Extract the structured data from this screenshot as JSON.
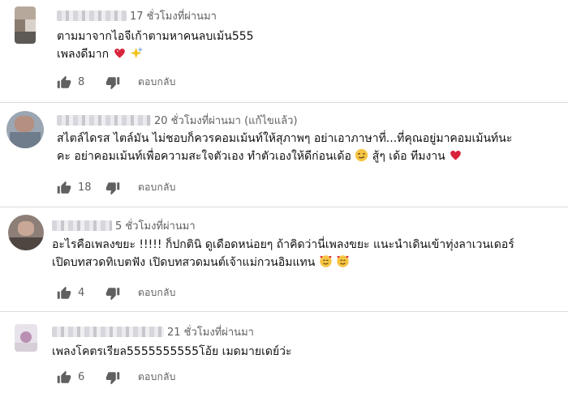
{
  "comments": [
    {
      "time": "17 ชั่วโมงที่ผ่านมา",
      "lines": [
        "ตามมาจากไอจีเก้าตามหาคนลบเม้น555",
        "เพลงดีมาก"
      ],
      "emojis": [
        "heart-sparkling-icon",
        "sparkles-icon"
      ],
      "likes": "8",
      "reply_label": "ตอบกลับ"
    },
    {
      "time": "20 ชั่วโมงที่ผ่านมา (แก้ไขแล้ว)",
      "lines": [
        "สไตล์ไดรส ไตล์มัน ไม่ชอบก็ควรคอมเม้นท์ให้สุภาพๆ อย่าเอาภาษาที่...ที่คุณอยู่มาคอมเม้นท์นะ",
        "คะ  อย่าคอมเม้นท์เพื่อความสะใจตัวเอง ทำตัวเองให้ดีก่อนเด้อ",
        " สู้ๆ เด้อ ทีมงาน"
      ],
      "emojis": [
        "smirk-face-icon",
        "red-heart-icon"
      ],
      "likes": "18",
      "reply_label": "ตอบกลับ"
    },
    {
      "time": "5 ชั่วโมงที่ผ่านมา",
      "lines": [
        "อะไรคือเพลงขยะ !!!!! ก็ปกตินิ ดูเดือดหน่อยๆ ถ้าคิดว่านี่เพลงขยะ แนะนำเดินเข้าทุ่งลาเวนเดอร์",
        "เปิดบทสวดทิเบตฟัง เปิดบทสวดมนต์เจ้าแม่กวนอิมแทน"
      ],
      "emojis": [
        "smiling-hearts-face-icon",
        "smiling-hearts-face-icon"
      ],
      "likes": "4",
      "reply_label": "ตอบกลับ"
    },
    {
      "time": "21 ชั่วโมงที่ผ่านมา",
      "lines": [
        "เพลงโคตรเรียล5555555555โอ้ย เมดมายเดย์ว่ะ"
      ],
      "emojis": [],
      "likes": "6",
      "reply_label": "ตอบกลับ"
    }
  ],
  "colors": {
    "meta_gray": "#606060",
    "text": "#111111",
    "divider": "#dcdcdc",
    "heart_red": "#d8243b"
  }
}
